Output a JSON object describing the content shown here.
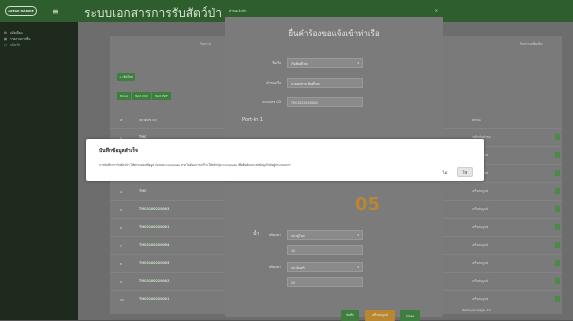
{
  "sidebar": {
    "logo_text": "eREGR MARINE",
    "menu_icon": "menu-icon",
    "items": [
      {
        "label": "แจ้งเตือน",
        "icon": "gear-icon"
      },
      {
        "label": "รายงานการยื่น",
        "icon": "document-icon"
      },
      {
        "label": "แจ้งเข้า",
        "icon": "circle-icon"
      }
    ]
  },
  "header": {
    "page_title": "ระบบเอกสารการรับสัตว์ป่า"
  },
  "list": {
    "section_left": "รับถาวร",
    "section_right": "กิจกรรมเพิ่มเติม",
    "add_button": "+ เพิ่มใหม่",
    "export_buttons": [
      "Excel",
      "Text CSV",
      "Text PDF"
    ],
    "columns": [
      "#",
      "หมายเลข CD",
      "สถานะ"
    ],
    "rows": [
      {
        "idx": "1",
        "code": "THC",
        "status": "รอยืนยันคำขอ"
      },
      {
        "idx": "2",
        "code": "THC",
        "status": "เสร็จสมบูรณ์"
      },
      {
        "idx": "3",
        "code": "THC",
        "status": "เสร็จสมบูรณ์"
      },
      {
        "idx": "4",
        "code": "THC",
        "status": "เสร็จสมบูรณ์"
      },
      {
        "idx": "5",
        "code": "THC0100220003",
        "status": "เสร็จสมบูรณ์"
      },
      {
        "idx": "6",
        "code": "THC0100220001",
        "status": "เสร็จสมบูรณ์"
      },
      {
        "idx": "7",
        "code": "THC0100220004",
        "status": "เสร็จสมบูรณ์"
      },
      {
        "idx": "8",
        "code": "THC0100220003",
        "status": "เสร็จสมบูรณ์"
      },
      {
        "idx": "9",
        "code": "THC0100220002",
        "status": "เสร็จสมบูรณ์"
      },
      {
        "idx": "10",
        "code": "THC0100220001",
        "status": "เสร็จสมบูรณ์"
      }
    ],
    "pagination": "Items per page: 10"
  },
  "form_modal": {
    "head": "คำขอแจ้งเข้า",
    "title": "ยื่นคำร้องขอแจ้งเข้าท่าเรือ",
    "fields": [
      {
        "label": "ชื่อเรือ",
        "value": "เรือพิมพ์ไทย",
        "dropdown": true
      },
      {
        "label": "เจ้าของเรือ",
        "value": "นายสมชาย พิมพ์ไทย",
        "dropdown": false
      },
      {
        "label": "หมายเลข CD",
        "value": "THC0210520002",
        "dropdown": false
      }
    ],
    "port_in": "Port-in 1",
    "multiplier_label": "น้ำ",
    "big_value": "05",
    "species": [
      {
        "label": "ชนิดปลา",
        "value": "ปลาทูไทย",
        "amount": "10"
      },
      {
        "label": "ชนิดปลา",
        "value": "ปลาอินทรี",
        "amount": "20"
      }
    ],
    "buttons": [
      "บันทึก",
      "เสร็จสมบูรณ์",
      "Close"
    ]
  },
  "dialog": {
    "title": "บันทึกข้อมูลสำเร็จ",
    "message": "การบันทึกการรับสัตว์ป่า ให้ตรวจสอบข้อมูล ก่อนกด Complete หากไม่ต้องการแก้ไข ให้คลิกปุ่ม Complete เพื่อยืนยันและส่งข้อมูลไปยังผู้ประกอบการ",
    "no_label": "ไม่",
    "yes_label": "ใช่"
  }
}
